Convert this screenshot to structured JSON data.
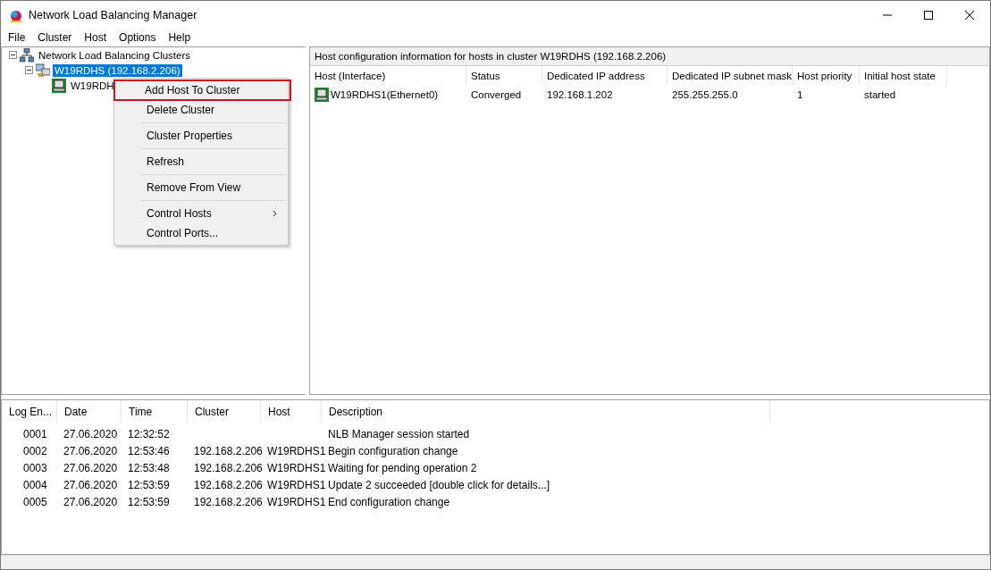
{
  "window": {
    "title": "Network Load Balancing Manager"
  },
  "menu_bar": [
    "File",
    "Cluster",
    "Host",
    "Options",
    "Help"
  ],
  "tree": {
    "label": "Network Load Balancing Clusters",
    "expanded": true,
    "selected": false,
    "children": [
      {
        "label": "W19RDHS (192.168.2.206)",
        "expanded": true,
        "selected": true,
        "children": [
          {
            "label": "W19RDH",
            "selected": false
          }
        ]
      }
    ]
  },
  "hosts_panel": {
    "title": "Host configuration information for hosts in cluster W19RDHS (192.168.2.206)",
    "columns": [
      "Host (Interface)",
      "Status",
      "Dedicated IP address",
      "Dedicated IP subnet mask",
      "Host priority",
      "Initial host state"
    ],
    "rows": [
      [
        "W19RDHS1(Ethernet0)",
        "Converged",
        "192.168.1.202",
        "255.255.255.0",
        "1",
        "started"
      ]
    ]
  },
  "log": {
    "columns": [
      "Log En...",
      "Date",
      "Time",
      "Cluster",
      "Host",
      "Description"
    ],
    "rows": [
      [
        "0001",
        "27.06.2020",
        "12:32:52",
        "",
        "",
        "NLB Manager session started"
      ],
      [
        "0002",
        "27.06.2020",
        "12:53:46",
        "192.168.2.206",
        "W19RDHS1",
        "Begin configuration change"
      ],
      [
        "0003",
        "27.06.2020",
        "12:53:48",
        "192.168.2.206",
        "W19RDHS1",
        "Waiting for pending operation 2"
      ],
      [
        "0004",
        "27.06.2020",
        "12:53:59",
        "192.168.2.206",
        "W19RDHS1",
        "Update 2 succeeded [double click for details...]"
      ],
      [
        "0005",
        "27.06.2020",
        "12:53:59",
        "192.168.2.206",
        "W19RDHS1",
        "End configuration change"
      ]
    ]
  },
  "context_menu": [
    {
      "label": "Add Host To Cluster",
      "highlighted": true,
      "separator_after": false,
      "submenu": false
    },
    {
      "label": "Delete Cluster",
      "highlighted": false,
      "separator_after": true,
      "submenu": false
    },
    {
      "label": "Cluster Properties",
      "highlighted": false,
      "separator_after": true,
      "submenu": false
    },
    {
      "label": "Refresh",
      "highlighted": false,
      "separator_after": true,
      "submenu": false
    },
    {
      "label": "Remove From View",
      "highlighted": false,
      "separator_after": true,
      "submenu": false
    },
    {
      "label": "Control Hosts",
      "highlighted": false,
      "separator_after": false,
      "submenu": true
    },
    {
      "label": "Control Ports...",
      "highlighted": false,
      "separator_after": false,
      "submenu": false
    }
  ]
}
